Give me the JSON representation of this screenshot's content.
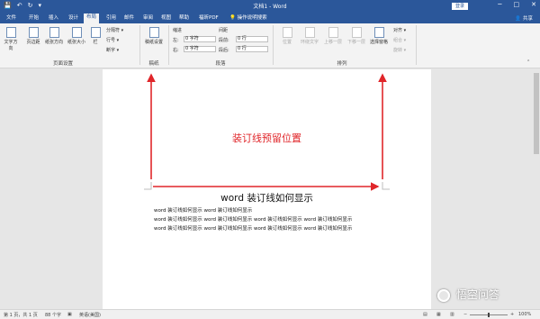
{
  "window": {
    "title": "文档1 - Word",
    "login": "登录",
    "share": "共享",
    "window_buttons": [
      "─",
      "□",
      "✕"
    ],
    "quick_access": [
      "💾",
      "↶",
      "↻",
      "▾"
    ]
  },
  "tabs": [
    "文件",
    "开始",
    "插入",
    "设计",
    "布局",
    "引用",
    "邮件",
    "审阅",
    "视图",
    "帮助",
    "福昕PDF"
  ],
  "active_tab": "布局",
  "tell_me": "操作说明搜索",
  "ribbon": {
    "page_setup": {
      "buttons": [
        "文字方向",
        "页边距",
        "纸张方向",
        "纸张大小",
        "栏"
      ],
      "small": [
        "分隔符 ▾",
        "行号 ▾",
        "断字 ▾"
      ],
      "label": "页面设置"
    },
    "draft": {
      "button": "稿纸设置",
      "label": "稿纸"
    },
    "paragraph": {
      "indent_title": "缩进",
      "spacing_title": "间距",
      "indent_left_label": "左:",
      "indent_left_value": "0 字符",
      "indent_right_label": "右:",
      "indent_right_value": "0 字符",
      "before_label": "段前:",
      "before_value": "0 行",
      "after_label": "段后:",
      "after_value": "0 行",
      "label": "段落"
    },
    "arrange": {
      "buttons": [
        "位置",
        "环绕文字",
        "上移一层",
        "下移一层",
        "选择窗格"
      ],
      "small": [
        "对齐 ▾",
        "组合 ▾",
        "旋转 ▾"
      ],
      "label": "排列"
    }
  },
  "document": {
    "annotation": "装订线预留位置",
    "heading": "word 装订线如何显示",
    "lines": [
      "word 装订线如何显示 word 装订线如何显示",
      "word 装订线如何显示 word 装订线如何显示 word 装订线如何显示 word 装订线如何显示",
      "word 装订线如何显示 word 装订线如何显示 word 装订线如何显示 word 装订线如何显示"
    ]
  },
  "status": {
    "page": "第 1 页，共 1 页",
    "words": "88 个字",
    "language": "英语(美国)",
    "zoom": "100%"
  },
  "watermark": "悟空问答",
  "colors": {
    "accent": "#2b579a",
    "annotation": "#e0262a"
  }
}
